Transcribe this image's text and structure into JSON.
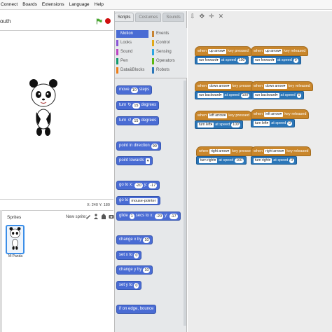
{
  "menu": [
    "Connect",
    "Boards",
    "Extensions",
    "Language",
    "Help"
  ],
  "project": {
    "name": "outh"
  },
  "stage": {
    "coords": "X: 240  Y: 180"
  },
  "sprites": {
    "title": "Sprites",
    "new_sprite_label": "New sprite:",
    "items": [
      {
        "name": "M-Panda"
      }
    ]
  },
  "tabs": [
    "Scripts",
    "Costumes",
    "Sounds"
  ],
  "categories": {
    "left": [
      {
        "label": "Motion",
        "color": "#4a6cd4"
      },
      {
        "label": "Looks",
        "color": "#8a55d7"
      },
      {
        "label": "Sound",
        "color": "#bb42c3"
      },
      {
        "label": "Pen",
        "color": "#0e9a6c"
      },
      {
        "label": "Data&Blocks",
        "color": "#ee7d16"
      }
    ],
    "right": [
      {
        "label": "Events",
        "color": "#c88330"
      },
      {
        "label": "Control",
        "color": "#e1a91a"
      },
      {
        "label": "Sensing",
        "color": "#2ca5e2"
      },
      {
        "label": "Operators",
        "color": "#5cb712"
      },
      {
        "label": "Robots",
        "color": "#2b76b8"
      }
    ]
  },
  "palette": {
    "move": {
      "text": "move",
      "value": "10",
      "suffix": "steps"
    },
    "turn_right": {
      "text": "turn",
      "icon": "↻",
      "value": "15",
      "suffix": "degrees"
    },
    "turn_left": {
      "text": "turn",
      "icon": "↺",
      "value": "15",
      "suffix": "degrees"
    },
    "point_dir": {
      "text": "point in direction",
      "value": "90"
    },
    "point_towards": {
      "text": "point towards"
    },
    "goto_xy": {
      "text": "go to x:",
      "x": "-20",
      "ylabel": "y:",
      "y": "-17"
    },
    "goto": {
      "text": "go to",
      "target": "mouse-pointer"
    },
    "glide": {
      "text": "glide",
      "secs": "1",
      "mid": "secs to x:",
      "x": "-20",
      "ylabel": "y:",
      "y": "-17"
    },
    "change_x": {
      "text": "change x by",
      "value": "10"
    },
    "set_x": {
      "text": "set x to",
      "value": "0"
    },
    "change_y": {
      "text": "change y by",
      "value": "10"
    },
    "set_y": {
      "text": "set y to",
      "value": "0"
    },
    "bounce": {
      "text": "if on edge, bounce"
    }
  },
  "scripts": [
    {
      "hat_when": "when",
      "key": "up arrow",
      "event": "key pressed",
      "cmd": "run forward",
      "speed_label": "at speed",
      "speed": "100"
    },
    {
      "hat_when": "when",
      "key": "up arrow",
      "event": "key released",
      "cmd": "run forward",
      "speed_label": "at speed",
      "speed": "0"
    },
    {
      "hat_when": "when",
      "key": "down arrow",
      "event": "key pressed",
      "cmd": "run backward",
      "speed_label": "at speed",
      "speed": "100"
    },
    {
      "hat_when": "when",
      "key": "down arrow",
      "event": "key released",
      "cmd": "run backward",
      "speed_label": "at speed",
      "speed": "0"
    },
    {
      "hat_when": "when",
      "key": "left arrow",
      "event": "key pressed",
      "cmd": "turn left",
      "speed_label": "at speed",
      "speed": "100"
    },
    {
      "hat_when": "when",
      "key": "left arrow",
      "event": "key released",
      "cmd": "turn left",
      "speed_label": "at speed",
      "speed": "0"
    },
    {
      "hat_when": "when",
      "key": "right arrow",
      "event": "key pressed",
      "cmd": "turn right",
      "speed_label": "at speed",
      "speed": "100"
    },
    {
      "hat_when": "when",
      "key": "right arrow",
      "event": "key released",
      "cmd": "turn right",
      "speed_label": "at speed",
      "speed": "0"
    }
  ]
}
